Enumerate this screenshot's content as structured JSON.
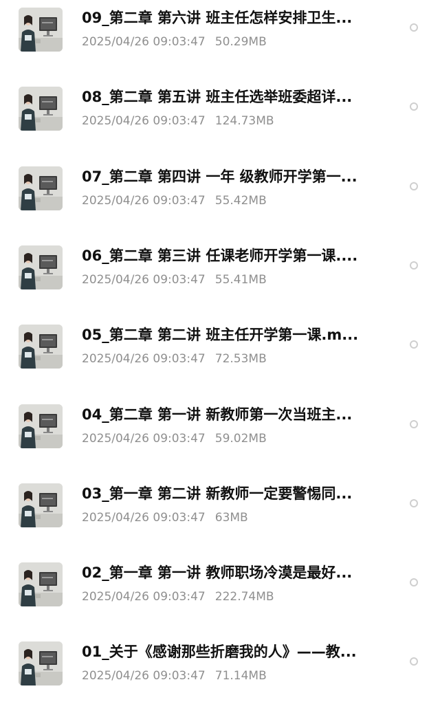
{
  "files": [
    {
      "title": "09_第二章 第六讲 班主任怎样安排卫生...",
      "date": "2025/04/26 09:03:47",
      "size": "50.29MB",
      "thumbnail_icon": "video-thumbnail-icon"
    },
    {
      "title": "08_第二章 第五讲 班主任选举班委超详...",
      "date": "2025/04/26 09:03:47",
      "size": "124.73MB",
      "thumbnail_icon": "video-thumbnail-icon"
    },
    {
      "title": "07_第二章 第四讲 一年 级教师开学第一...",
      "date": "2025/04/26 09:03:47",
      "size": "55.42MB",
      "thumbnail_icon": "video-thumbnail-icon"
    },
    {
      "title": "06_第二章 第三讲 任课老师开学第一课....",
      "date": "2025/04/26 09:03:47",
      "size": "55.41MB",
      "thumbnail_icon": "video-thumbnail-icon"
    },
    {
      "title": "05_第二章 第二讲 班主任开学第一课.m...",
      "date": "2025/04/26 09:03:47",
      "size": "72.53MB",
      "thumbnail_icon": "video-thumbnail-icon"
    },
    {
      "title": "04_第二章 第一讲 新教师第一次当班主...",
      "date": "2025/04/26 09:03:47",
      "size": "59.02MB",
      "thumbnail_icon": "video-thumbnail-icon"
    },
    {
      "title": "03_第一章 第二讲 新教师一定要警惕同...",
      "date": "2025/04/26 09:03:47",
      "size": "63MB",
      "thumbnail_icon": "video-thumbnail-icon"
    },
    {
      "title": "02_第一章 第一讲 教师职场冷漠是最好...",
      "date": "2025/04/26 09:03:47",
      "size": "222.74MB",
      "thumbnail_icon": "video-thumbnail-icon"
    },
    {
      "title": "01_关于《感谢那些折磨我的人》——教...",
      "date": "2025/04/26 09:03:47",
      "size": "71.14MB",
      "thumbnail_icon": "video-thumbnail-icon"
    }
  ],
  "colors": {
    "title": "#111111",
    "meta": "#8f8f8f",
    "radio_border": "#cfcfcf",
    "background": "#ffffff"
  }
}
